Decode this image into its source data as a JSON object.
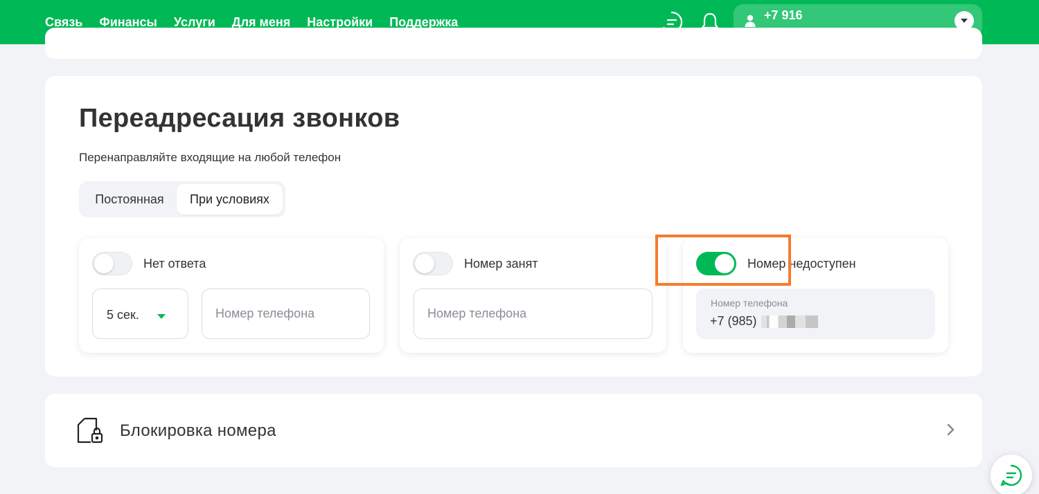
{
  "header": {
    "nav": [
      "Связь",
      "Финансы",
      "Услуги",
      "Для меня",
      "Настройки",
      "Поддержка"
    ],
    "active_nav": "Настройки",
    "profile_phone": "+7 916",
    "icons": [
      "chat-icon",
      "bell-icon",
      "user-icon",
      "chevron-down-icon"
    ]
  },
  "forwarding": {
    "title": "Переадресация звонков",
    "subtitle": "Перенаправляйте входящие на любой телефон",
    "tabs": [
      {
        "label": "Постоянная",
        "selected": false
      },
      {
        "label": "При условиях",
        "selected": true
      }
    ],
    "options": [
      {
        "label": "Нет ответа",
        "enabled": false,
        "delay": "5 сек.",
        "phone_placeholder": "Номер телефона"
      },
      {
        "label": "Номер занят",
        "enabled": false,
        "phone_placeholder": "Номер телефона"
      },
      {
        "label": "Номер недоступен",
        "enabled": true,
        "phone_label": "Номер телефона",
        "phone_value": "+7 (985)"
      }
    ]
  },
  "block": {
    "title": "Блокировка номера"
  },
  "colors": {
    "brand_green": "#00b956",
    "highlight": "#f57c2a"
  }
}
